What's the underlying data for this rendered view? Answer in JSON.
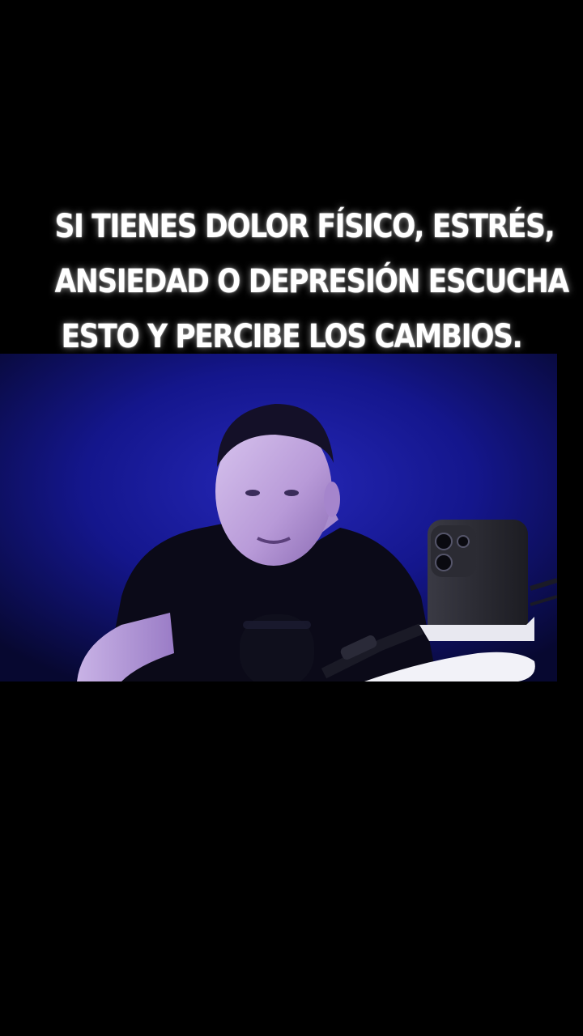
{
  "caption": {
    "lines": [
      "SI TIENES DOLOR FÍSICO, ESTRÉS,",
      "ANSIEDAD O DEPRESIÓN ESCUCHA",
      "ESTO Y PERCIBE LOS CAMBIOS."
    ]
  },
  "video": {
    "background_color": "#14158a",
    "scene": "person-with-microphone-and-phone"
  }
}
